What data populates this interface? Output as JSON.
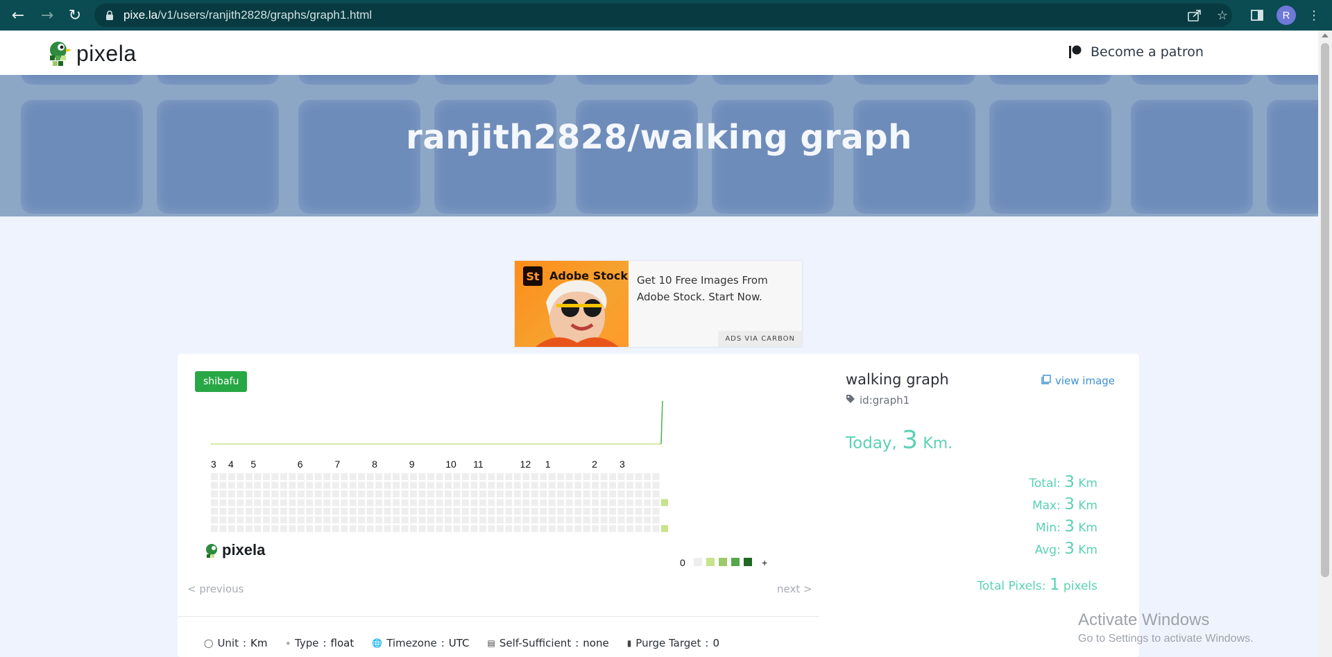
{
  "browser": {
    "url_host": "pixe.la",
    "url_path": "/v1/users/ranjith2828/graphs/graph1.html",
    "profile_initial": "R"
  },
  "header": {
    "logo_text": "pixela",
    "patron_label": "Become a patron"
  },
  "hero": {
    "title": "ranjith2828/walking graph"
  },
  "ad": {
    "brand": "Adobe Stock",
    "brand_mark": "St",
    "text": "Get 10 Free Images From Adobe Stock. Start Now.",
    "via": "ADS VIA CARBON"
  },
  "graph": {
    "badge": "shibafu",
    "month_labels": [
      "3",
      "4",
      "5",
      "6",
      "7",
      "8",
      "9",
      "10",
      "11",
      "12",
      "1",
      "2",
      "3"
    ],
    "footer_logo": "pixela",
    "legend_min": "0",
    "legend_max": "+",
    "legend_colors": [
      "#eeeeee",
      "#c6e48b",
      "#9dc96a",
      "#54a84a",
      "#1e6823"
    ],
    "empty_color": "#eeeeee",
    "filled_color": "#c6e48b",
    "line_color": "#c6e48b",
    "spike_color": "#4caf50",
    "prev": "< previous",
    "next": "next >"
  },
  "meta": {
    "unit_label": "Unit",
    "unit_value": "Km",
    "type_label": "Type",
    "type_value": "float",
    "timezone_label": "Timezone",
    "timezone_value": "UTC",
    "self_label": "Self-Sufficient",
    "self_value": "none",
    "purge_label": "Purge Target",
    "purge_value": "0"
  },
  "side": {
    "title": "walking graph",
    "id": "id:graph1",
    "view_image": "view image",
    "today_label": "Today",
    "today_comma": ",",
    "today_value": "3",
    "today_unit": "Km.",
    "total_label": "Total:",
    "total_value": "3",
    "total_unit": "Km",
    "max_label": "Max:",
    "max_value": "3",
    "max_unit": "Km",
    "min_label": "Min:",
    "min_value": "3",
    "min_unit": "Km",
    "avg_label": "Avg:",
    "avg_value": "3",
    "avg_unit": "Km",
    "pixels_label": "Total Pixels:",
    "pixels_value": "1",
    "pixels_unit": "pixels"
  },
  "watermark": {
    "line1": "Activate Windows",
    "line2": "Go to Settings to activate Windows."
  }
}
